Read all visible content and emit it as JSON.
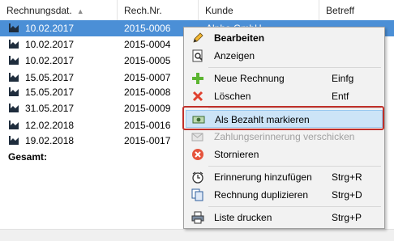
{
  "table": {
    "headers": {
      "date": "Rechnungsdat.",
      "number": "Rech.Nr.",
      "customer": "Kunde",
      "subject": "Betreff"
    },
    "rows": [
      {
        "date": "10.02.2017",
        "number": "2015-0006",
        "customer": "Alpha GmbH",
        "selected": true
      },
      {
        "date": "10.02.2017",
        "number": "2015-0004",
        "customer": ""
      },
      {
        "date": "10.02.2017",
        "number": "2015-0005",
        "customer": ""
      },
      {
        "date": "15.05.2017",
        "number": "2015-0007",
        "customer": ""
      },
      {
        "date": "15.05.2017",
        "number": "2015-0008",
        "customer": ""
      },
      {
        "date": "31.05.2017",
        "number": "2015-0009",
        "customer": ""
      },
      {
        "date": "12.02.2018",
        "number": "2015-0016",
        "customer": ""
      },
      {
        "date": "19.02.2018",
        "number": "2015-0017",
        "customer": ""
      }
    ],
    "total_label": "Gesamt:"
  },
  "menu": {
    "items": [
      {
        "label": "Bearbeiten",
        "shortcut": "",
        "icon": "pencil-icon"
      },
      {
        "label": "Anzeigen",
        "shortcut": "",
        "icon": "view-icon"
      },
      {
        "label": "Neue Rechnung",
        "shortcut": "Einfg",
        "icon": "plus-icon"
      },
      {
        "label": "Löschen",
        "shortcut": "Entf",
        "icon": "delete-icon"
      },
      {
        "label": "Als Bezahlt markieren",
        "shortcut": "",
        "icon": "money-icon"
      },
      {
        "label": "Zahlungserinnerung verschicken",
        "shortcut": "",
        "icon": "reminder-letter-icon"
      },
      {
        "label": "Stornieren",
        "shortcut": "",
        "icon": "cancel-icon"
      },
      {
        "label": "Erinnerung hinzufügen",
        "shortcut": "Strg+R",
        "icon": "alarm-clock-icon"
      },
      {
        "label": "Rechnung duplizieren",
        "shortcut": "Strg+D",
        "icon": "duplicate-icon"
      },
      {
        "label": "Liste drucken",
        "shortcut": "Strg+P",
        "icon": "printer-icon"
      }
    ]
  },
  "colors": {
    "selection": "#4b8fd6",
    "menu_highlight": "#cce4f7",
    "highlight_frame": "#c0302a"
  }
}
